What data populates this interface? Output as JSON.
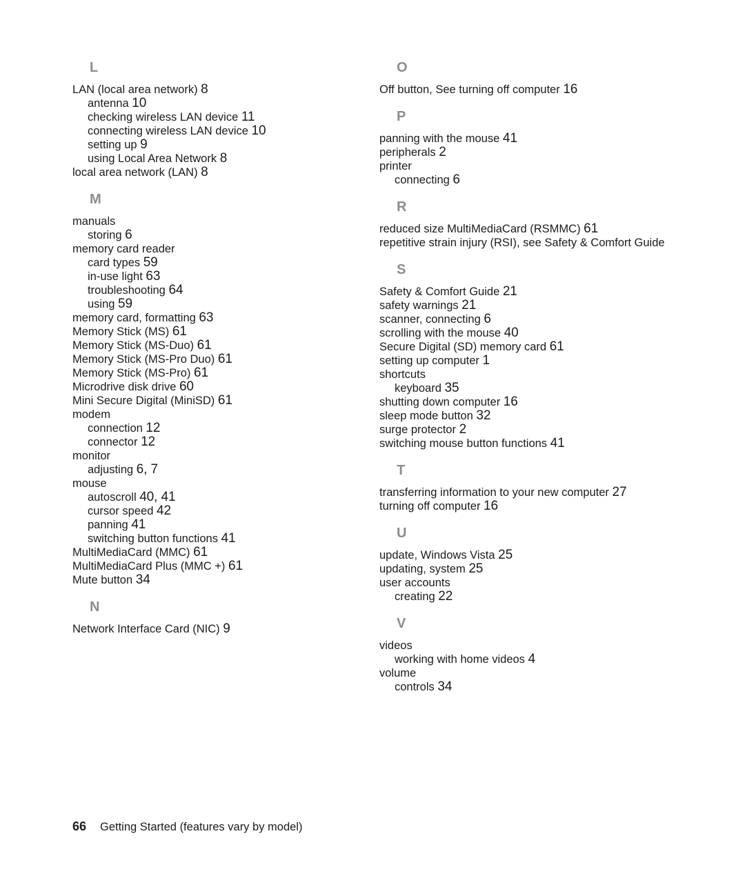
{
  "document": {
    "type": "index",
    "footer": {
      "page_number": "66",
      "text": "Getting Started (features vary by model)"
    }
  },
  "columns": [
    {
      "name": "left-column",
      "sections": [
        {
          "letter": "L",
          "entries": [
            {
              "text": "LAN (local area network)",
              "page": "8",
              "level": 0
            },
            {
              "text": "antenna",
              "page": "10",
              "level": 1
            },
            {
              "text": "checking wireless LAN device",
              "page": "11",
              "level": 1
            },
            {
              "text": "connecting wireless LAN device",
              "page": "10",
              "level": 1
            },
            {
              "text": "setting up",
              "page": "9",
              "level": 1
            },
            {
              "text": "using Local Area Network",
              "page": "8",
              "level": 1
            },
            {
              "text": "local area network (LAN)",
              "page": "8",
              "level": 0
            }
          ]
        },
        {
          "letter": "M",
          "entries": [
            {
              "text": "manuals",
              "page": "",
              "level": 0
            },
            {
              "text": "storing",
              "page": "6",
              "level": 1
            },
            {
              "text": "memory card reader",
              "page": "",
              "level": 0
            },
            {
              "text": "card types",
              "page": "59",
              "level": 1
            },
            {
              "text": "in-use light",
              "page": "63",
              "level": 1
            },
            {
              "text": "troubleshooting",
              "page": "64",
              "level": 1
            },
            {
              "text": "using",
              "page": "59",
              "level": 1
            },
            {
              "text": "memory card, formatting",
              "page": "63",
              "level": 0
            },
            {
              "text": "Memory Stick (MS)",
              "page": "61",
              "level": 0
            },
            {
              "text": "Memory Stick (MS-Duo)",
              "page": "61",
              "level": 0
            },
            {
              "text": "Memory Stick (MS-Pro Duo)",
              "page": "61",
              "level": 0
            },
            {
              "text": "Memory Stick (MS-Pro)",
              "page": "61",
              "level": 0
            },
            {
              "text": "Microdrive disk drive",
              "page": "60",
              "level": 0
            },
            {
              "text": "Mini Secure Digital (MiniSD)",
              "page": "61",
              "level": 0
            },
            {
              "text": "modem",
              "page": "",
              "level": 0
            },
            {
              "text": "connection",
              "page": "12",
              "level": 1
            },
            {
              "text": "connector",
              "page": "12",
              "level": 1
            },
            {
              "text": "monitor",
              "page": "",
              "level": 0
            },
            {
              "text": "adjusting",
              "page": "6, 7",
              "level": 1
            },
            {
              "text": "mouse",
              "page": "",
              "level": 0
            },
            {
              "text": "autoscroll",
              "page": "40, 41",
              "level": 1
            },
            {
              "text": "cursor speed",
              "page": "42",
              "level": 1
            },
            {
              "text": "panning",
              "page": "41",
              "level": 1
            },
            {
              "text": "switching button functions",
              "page": "41",
              "level": 1
            },
            {
              "text": "MultiMediaCard (MMC)",
              "page": "61",
              "level": 0
            },
            {
              "text": "MultiMediaCard Plus (MMC +)",
              "page": "61",
              "level": 0
            },
            {
              "text": "Mute button",
              "page": "34",
              "level": 0
            }
          ]
        },
        {
          "letter": "N",
          "entries": [
            {
              "text": "Network Interface Card (NIC)",
              "page": "9",
              "level": 0
            }
          ]
        }
      ]
    },
    {
      "name": "right-column",
      "sections": [
        {
          "letter": "O",
          "entries": [
            {
              "text": "Off button, See turning off computer",
              "page": "16",
              "level": 0
            }
          ]
        },
        {
          "letter": "P",
          "entries": [
            {
              "text": "panning with the mouse",
              "page": "41",
              "level": 0
            },
            {
              "text": "peripherals",
              "page": "2",
              "level": 0
            },
            {
              "text": "printer",
              "page": "",
              "level": 0
            },
            {
              "text": "connecting",
              "page": "6",
              "level": 1
            }
          ]
        },
        {
          "letter": "R",
          "entries": [
            {
              "text": "reduced size MultiMediaCard (RSMMC)",
              "page": "61",
              "level": 0
            },
            {
              "text": "repetitive strain injury (RSI), see Safety & Comfort Guide",
              "page": "",
              "level": 0
            }
          ]
        },
        {
          "letter": "S",
          "entries": [
            {
              "text": "Safety & Comfort Guide",
              "page": "21",
              "level": 0
            },
            {
              "text": "safety warnings",
              "page": "21",
              "level": 0
            },
            {
              "text": "scanner, connecting",
              "page": "6",
              "level": 0
            },
            {
              "text": "scrolling with the mouse",
              "page": "40",
              "level": 0
            },
            {
              "text": "Secure Digital (SD) memory card",
              "page": "61",
              "level": 0
            },
            {
              "text": "setting up computer",
              "page": "1",
              "level": 0
            },
            {
              "text": "shortcuts",
              "page": "",
              "level": 0
            },
            {
              "text": "keyboard",
              "page": "35",
              "level": 1
            },
            {
              "text": "shutting down computer",
              "page": "16",
              "level": 0
            },
            {
              "text": "sleep mode button",
              "page": "32",
              "level": 0
            },
            {
              "text": "surge protector",
              "page": "2",
              "level": 0
            },
            {
              "text": "switching mouse button functions",
              "page": "41",
              "level": 0
            }
          ]
        },
        {
          "letter": "T",
          "entries": [
            {
              "text": "transferring information to your new computer",
              "page": "27",
              "level": 0
            },
            {
              "text": "turning off computer",
              "page": "16",
              "level": 0
            }
          ]
        },
        {
          "letter": "U",
          "entries": [
            {
              "text": "update, Windows Vista",
              "page": "25",
              "level": 0
            },
            {
              "text": "updating, system",
              "page": "25",
              "level": 0
            },
            {
              "text": "user accounts",
              "page": "",
              "level": 0
            },
            {
              "text": "creating",
              "page": "22",
              "level": 1
            }
          ]
        },
        {
          "letter": "V",
          "entries": [
            {
              "text": "videos",
              "page": "",
              "level": 0
            },
            {
              "text": "working with home videos",
              "page": "4",
              "level": 1
            },
            {
              "text": "volume",
              "page": "",
              "level": 0
            },
            {
              "text": "controls",
              "page": "34",
              "level": 1
            }
          ]
        }
      ]
    }
  ]
}
